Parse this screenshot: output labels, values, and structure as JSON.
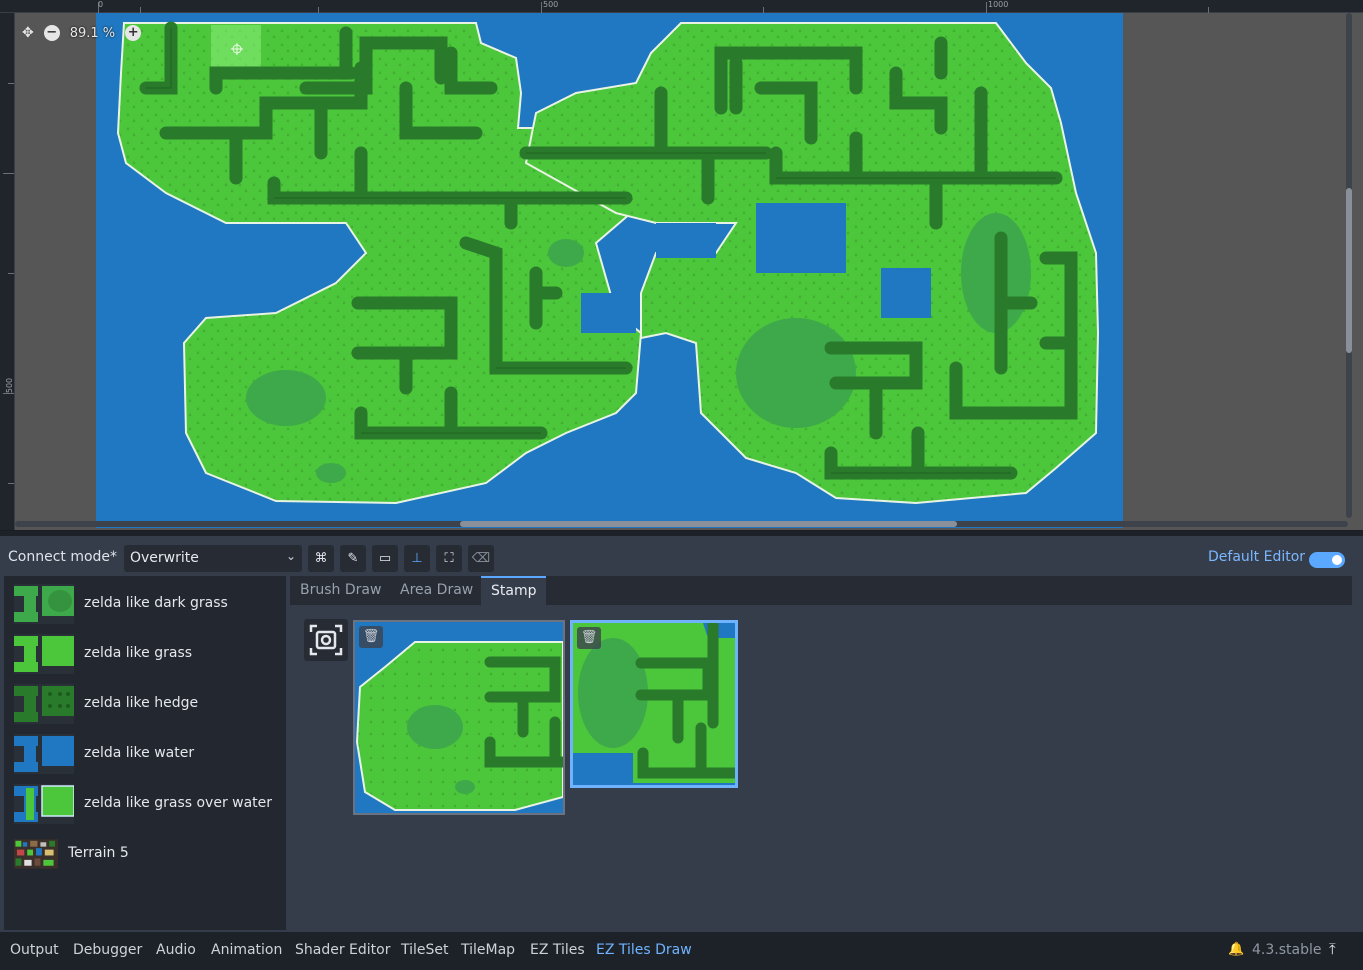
{
  "viewport": {
    "zoom_label": "89.1 %",
    "ruler_top_labels": [
      "0",
      "500",
      "1000"
    ],
    "ruler_left_labels": [
      "500"
    ]
  },
  "toolbar": {
    "connect_mode_label": "Connect mode*",
    "connect_mode_value": "Overwrite",
    "tools": [
      "connect-icon",
      "pencil-icon",
      "rectangle-icon",
      "line-icon",
      "stamp-capture-icon",
      "eraser-icon"
    ],
    "active_tool": "line-icon",
    "default_editor_label": "Default Editor",
    "default_editor_on": true
  },
  "terrains": [
    {
      "label": "zelda like dark grass"
    },
    {
      "label": "zelda like grass"
    },
    {
      "label": "zelda like hedge"
    },
    {
      "label": "zelda like water"
    },
    {
      "label": "zelda like grass over water"
    },
    {
      "label": "Terrain 5"
    }
  ],
  "tabs": [
    {
      "label": "Brush Draw"
    },
    {
      "label": "Area Draw"
    },
    {
      "label": "Stamp"
    }
  ],
  "active_tab": "Stamp",
  "dock": {
    "items": [
      "Output",
      "Debugger",
      "Audio",
      "Animation",
      "Shader Editor",
      "TileSet",
      "TileMap",
      "EZ Tiles",
      "EZ Tiles Draw"
    ],
    "active": "EZ Tiles Draw",
    "version": "4.3.stable"
  },
  "colors": {
    "water": "#1f78c1",
    "grass": "#4cc63a",
    "dark_grass": "#3ea94a",
    "hedge": "#2a7a2c",
    "accent": "#5aa8ff"
  }
}
